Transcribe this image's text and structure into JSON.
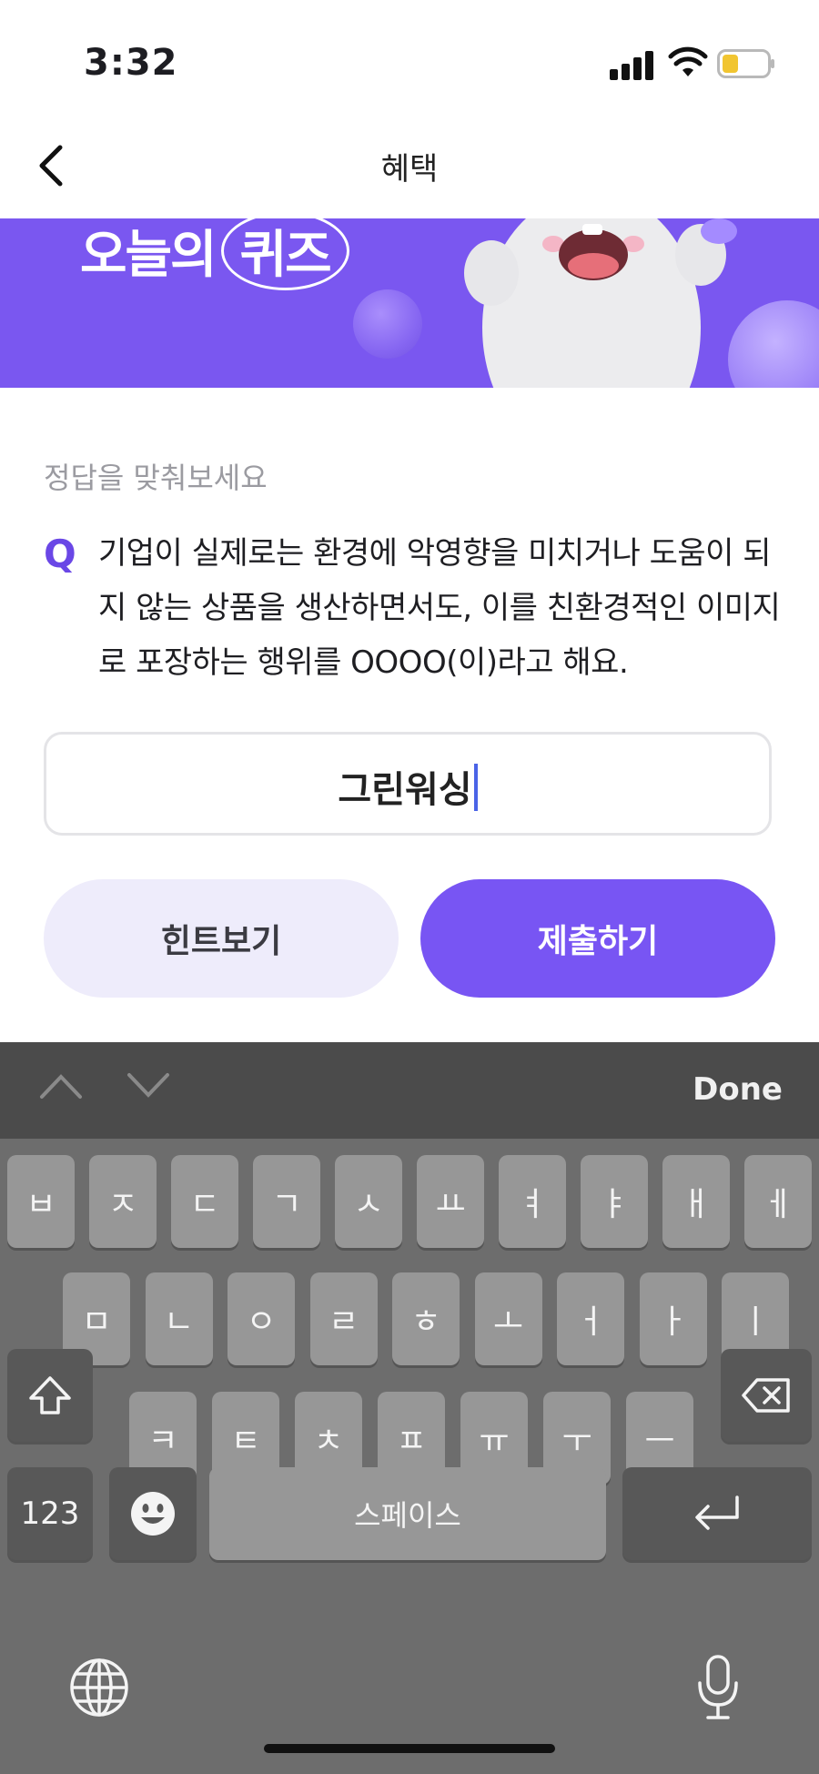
{
  "status": {
    "time": "3:32"
  },
  "nav": {
    "title": "혜택"
  },
  "banner": {
    "title_part1": "오늘의",
    "title_part2": "퀴즈"
  },
  "quiz": {
    "label": "정답을 맞춰보세요",
    "q_mark": "Q",
    "question": "기업이 실제로는 환경에 악영향을 미치거나 도움이 되지 않는 상품을 생산하면서도, 이를 친환경적인 이미지로 포장하는 행위를 OOOO(이)라고 해요.",
    "answer_value": "그린워싱",
    "hint_label": "힌트보기",
    "submit_label": "제출하기"
  },
  "keyboard": {
    "done_label": "Done",
    "row1": [
      "ㅂ",
      "ㅈ",
      "ㄷ",
      "ㄱ",
      "ㅅ",
      "ㅛ",
      "ㅕ",
      "ㅑ",
      "ㅐ",
      "ㅔ"
    ],
    "row2": [
      "ㅁ",
      "ㄴ",
      "ㅇ",
      "ㄹ",
      "ㅎ",
      "ㅗ",
      "ㅓ",
      "ㅏ",
      "ㅣ"
    ],
    "row3": [
      "ㅋ",
      "ㅌ",
      "ㅊ",
      "ㅍ",
      "ㅠ",
      "ㅜ",
      "ㅡ"
    ],
    "numbers_label": "123",
    "space_label": "스페이스",
    "icons": {
      "shift": "shift-icon",
      "delete": "delete-icon",
      "emoji": "emoji-icon",
      "return": "return-icon",
      "globe": "globe-icon",
      "mic": "microphone-icon"
    }
  },
  "colors": {
    "accent": "#7855f3",
    "banner": "#7a57f0",
    "keyboard": "#6d6d6d"
  }
}
